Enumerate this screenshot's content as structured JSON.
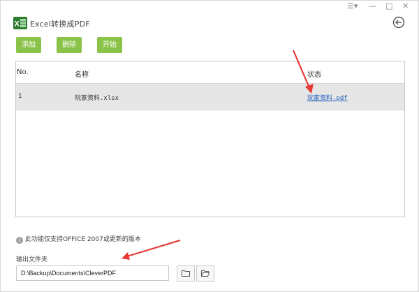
{
  "app": {
    "title": "Excel转换成PDF",
    "logo_icon": "excel-icon",
    "window_controls": [
      "☰▾",
      "—",
      "□",
      "✕"
    ]
  },
  "toolbar": {
    "add_label": "添加",
    "delete_label": "删除",
    "start_label": "开始",
    "accent_color": "#8bc34a"
  },
  "table": {
    "columns": [
      "No.",
      "名称",
      "状态"
    ],
    "rows": [
      {
        "no": "1",
        "name": "玩家资料.xlsx",
        "status": "玩家资料.pdf"
      }
    ]
  },
  "note": {
    "icon": "info-icon",
    "text": "此功能仅支持OFFICE 2007或更新的版本"
  },
  "output": {
    "label": "输出文件夹",
    "path": "D:\\Backup\\Documents\\CleverPDF"
  },
  "colors": {
    "link": "#1a5bbd",
    "arrow": "#e53935",
    "row_highlight": "#e6e6e6"
  }
}
